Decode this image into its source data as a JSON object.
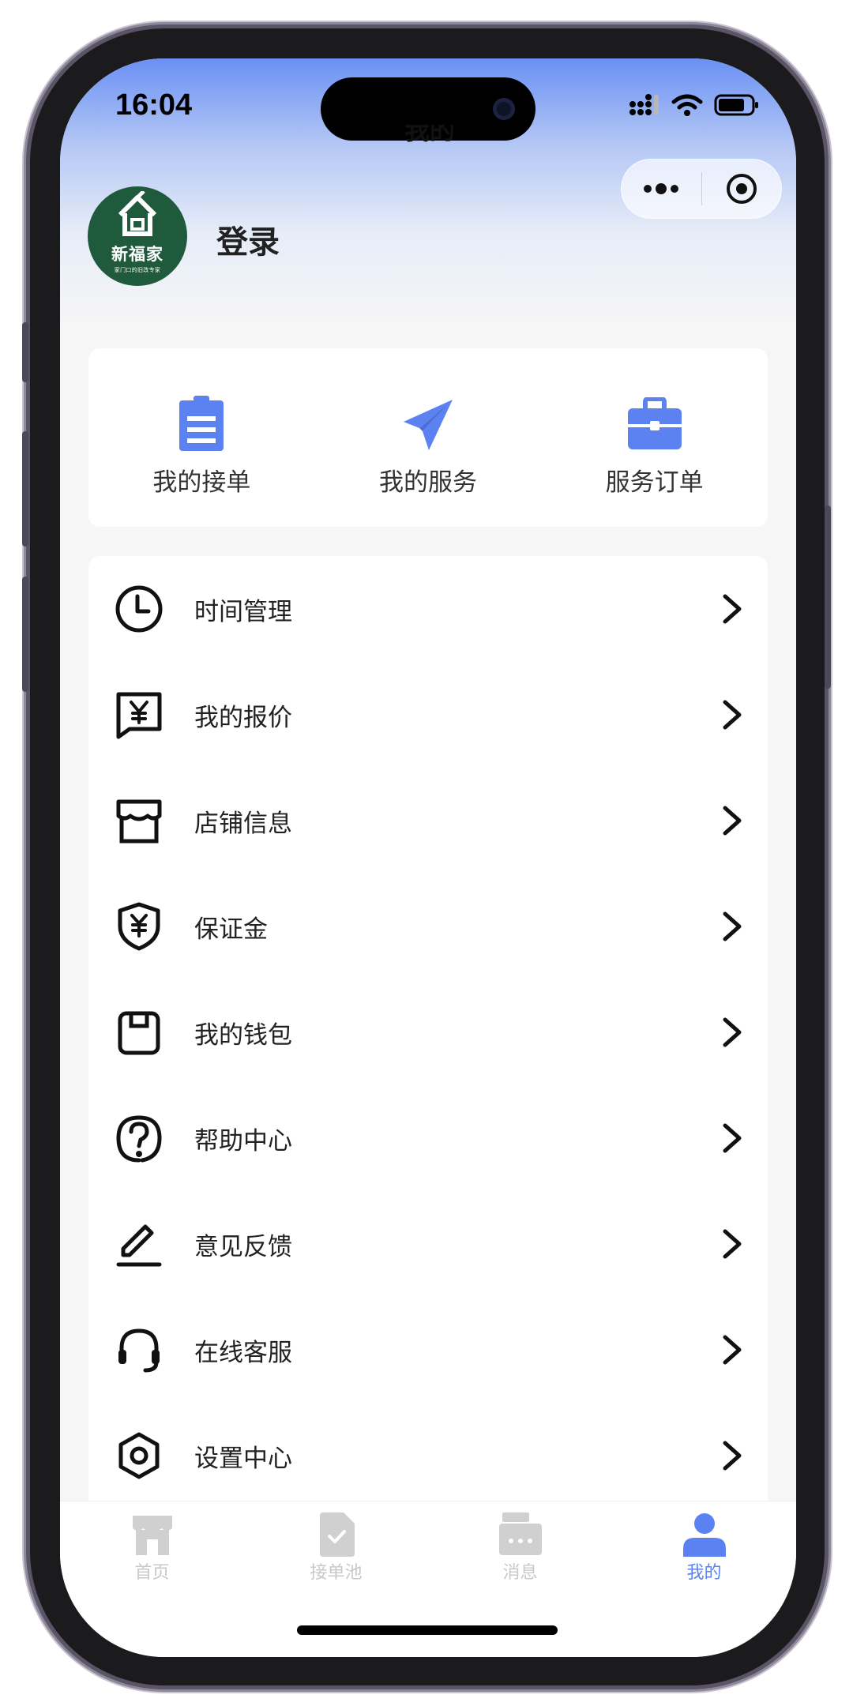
{
  "status_bar": {
    "time": "16:04"
  },
  "page": {
    "title": "我的"
  },
  "profile": {
    "brand": "新福家",
    "slogan": "家门口的旧改专家",
    "login": "登录"
  },
  "quick_actions": [
    {
      "label": "我的接单",
      "icon": "clipboard-icon"
    },
    {
      "label": "我的服务",
      "icon": "paper-plane-icon"
    },
    {
      "label": "服务订单",
      "icon": "briefcase-icon"
    }
  ],
  "menu": [
    {
      "label": "时间管理",
      "icon": "clock-icon"
    },
    {
      "label": "我的报价",
      "icon": "yen-message-icon"
    },
    {
      "label": "店铺信息",
      "icon": "store-icon"
    },
    {
      "label": "保证金",
      "icon": "yen-shield-icon"
    },
    {
      "label": "我的钱包",
      "icon": "wallet-icon"
    },
    {
      "label": "帮助中心",
      "icon": "help-icon"
    },
    {
      "label": "意见反馈",
      "icon": "pencil-icon"
    },
    {
      "label": "在线客服",
      "icon": "headset-icon"
    },
    {
      "label": "设置中心",
      "icon": "settings-icon"
    }
  ],
  "tabs": [
    {
      "label": "首页",
      "icon": "shop-icon",
      "active": false
    },
    {
      "label": "接单池",
      "icon": "document-check-icon",
      "active": false
    },
    {
      "label": "消息",
      "icon": "message-box-icon",
      "active": false
    },
    {
      "label": "我的",
      "icon": "user-icon",
      "active": true
    }
  ],
  "colors": {
    "accent": "#5b82f0",
    "tab_inactive": "#c8c8c8",
    "header_top": "#6a90f3",
    "avatar_bg": "#1f5a3c"
  }
}
